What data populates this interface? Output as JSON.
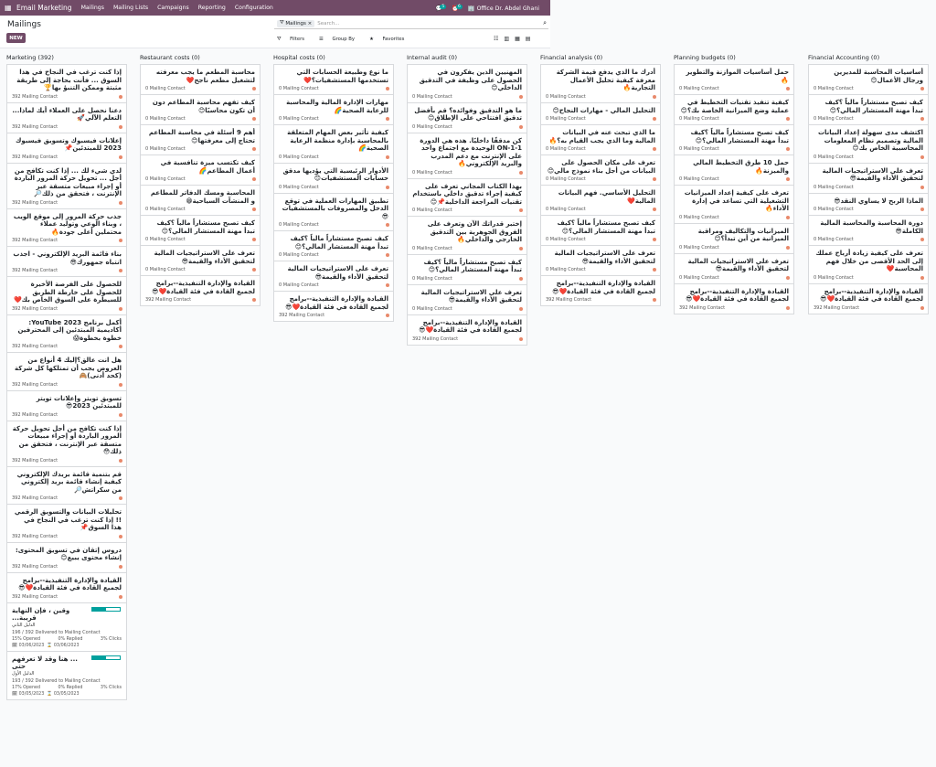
{
  "topbar": {
    "app_name": "Email Marketing",
    "menus": [
      "Mailings",
      "Mailing Lists",
      "Campaigns",
      "Reporting",
      "Configuration"
    ],
    "chat_count": "5",
    "activity_count": "6",
    "company": "Office Dr. Abdel Ghani"
  },
  "control": {
    "breadcrumb": "Mailings",
    "new_label": "NEW",
    "facet_label": "Mailings",
    "search_placeholder": "Search...",
    "filters": "Filters",
    "group_by": "Group By",
    "favorites": "Favorites"
  },
  "columns": [
    {
      "title": "Marketing (392)",
      "cards": [
        {
          "title": "إذا كنت ترغب في النجاح في هذا السوق ... فأنت بحاجة إلى طريقة مثبتة وممكن التنبؤ بها🏆",
          "meta": "392 Mailing Contact"
        },
        {
          "title": "دعنا نحصل على العملاء أيك لماذا... التعلم الآلي🚀",
          "meta": "392 Mailing Contact"
        },
        {
          "title": "إعلانات فيسبوك وتسويق فيسبوك 2023 للمبتدئين📌",
          "meta": "392 Mailing Contact"
        },
        {
          "title": "لدي شيء لك ... إذا كنت تكافح من أجل ... تحويل حركة المرور الباردة أو إجراء مبيعات متسقة عبر الإنترنت ، فتحقق من ذلك🔎",
          "meta": "392 Mailing Contact"
        },
        {
          "title": "جذب حركة المرور إلى موقع الويب ، وبناء الوعي وتوليد عملاء محتملين أعلى جودة🔥",
          "meta": "392 Mailing Contact"
        },
        {
          "title": "بناء قائمة البريد الإلكتروني - اجذب انتباه جمهورك😎",
          "meta": "392 Mailing Contact"
        },
        {
          "title": "للحصول على الفرصة الأخيرة للحصول على خارطة الطريق للسيطرة على السوق الخاص بك❤️",
          "meta": "392 Mailing Contact"
        },
        {
          "title": "أكمل برنامج YouTube 2023: أكاديمية المبتدئين إلى المحترفين خطوة بخطوة😱",
          "meta": "392 Mailing Contact"
        },
        {
          "title": "هل انت عالق؟إليك 4 أنواع من العروض يجب أن تمتلكها كل شركة (كحد أدنى)🙈",
          "meta": "392 Mailing Contact"
        },
        {
          "title": "تسويق تويتر وإعلانات تويتر للمبتدئين 2023😎",
          "meta": "392 Mailing Contact"
        },
        {
          "title": "إذا كنت تكافح من أجل تحويل حركة المرور الباردة أو إجراء مبيعات متسقة عبر الإنترنت ، فتحقق من ذلك😳",
          "meta": "392 Mailing Contact"
        },
        {
          "title": "قم بتنمية قائمة بريدك الإلكتروني كيفية إنشاء قائمة بريد إلكتروني من سكراتش🔎",
          "meta": "392 Mailing Contact"
        },
        {
          "title": "تحليلات البيانات والتسويق الرقمي !! إذا كنت ترغب في النجاح في هذا السوق📌",
          "meta": "392 Mailing Contact"
        },
        {
          "title": "دروس إتقان في تسويق المحتوى: إنشاء محتوى يبيع😊",
          "meta": "392 Mailing Contact"
        },
        {
          "title": "القيادة والإدارة التنفيذية--برامج لجميع القادة في فئة القيادة❤️😎",
          "meta": "392 Mailing Contact"
        }
      ],
      "stat_cards": [
        {
          "title": "وقين ، فإن النهاية قريبة...",
          "subtitle": "الدليل الثاني",
          "progress": 0.5,
          "delivered": "196 / 392 Delivered to Mailing Contact",
          "opened": "15% Opened",
          "replied": "0% Replied",
          "clicks": "3% Clicks",
          "date_from": "03/06/2023",
          "date_to": "03/06/2023"
        },
        {
          "title": "... هنا وقد لا تعرفهم حتى",
          "subtitle": "الدليل الأول",
          "progress": 0.49,
          "delivered": "193 / 392 Delivered to Mailing Contact",
          "opened": "17% Opened",
          "replied": "0% Replied",
          "clicks": "3% Clicks",
          "date_from": "03/05/2023",
          "date_to": "03/05/2023"
        }
      ]
    },
    {
      "title": "Restaurant costs (0)",
      "cards": [
        {
          "title": "محاسبة المطعم ما يجب معرفته لتشغيل مطعم ناجح❤️",
          "meta": "0 Mailing Contact"
        },
        {
          "title": "كيف تفهم محاسبة المطاعم دون أن تكون محاسبًا😊",
          "meta": "0 Mailing Contact"
        },
        {
          "title": "أهم 9 أسئلة في محاسبة المطاعم تحتاج إلى معرفتها😊",
          "meta": "0 Mailing Contact"
        },
        {
          "title": "كيف تكتسب ميزة تنافسية في أعمال المطاعم🌈",
          "meta": "0 Mailing Contact"
        },
        {
          "title": "المحاسبة ومسك الدفاتر للمطاعم و المنشآت السياحية😁",
          "meta": "0 Mailing Contact"
        },
        {
          "title": "كيف تصبح مستشاراً مالياً ؟كيف تبدأ مهنة المستشار المالي؟😊",
          "meta": "0 Mailing Contact"
        },
        {
          "title": "تعرف على الاستراتيجيات المالية لتحقيق الأداء والقيمة😎",
          "meta": "0 Mailing Contact"
        },
        {
          "title": "القيادة والإدارة التنفيذية--برامج لجميع القادة في فئة القيادة❤️😎",
          "meta": "392 Mailing Contact"
        }
      ]
    },
    {
      "title": "Hospital costs (0)",
      "cards": [
        {
          "title": "ما نوع وطبيعة الحسابات التي تستخدمها المستشفيات؟❤️",
          "meta": "0 Mailing Contact"
        },
        {
          "title": "مهارات الإدارة المالية والمحاسبة للرعاية الصحية🌈",
          "meta": "0 Mailing Contact"
        },
        {
          "title": "كيفية تأثير بعض المهام المتعلقة بالمحاسبة بإدارة منظمة الرعاية الصحية🌈",
          "meta": "0 Mailing Contact"
        },
        {
          "title": "الأدوار الرئيسية التي يؤديها مدقق حسابات المستشفيات😊",
          "meta": "0 Mailing Contact"
        },
        {
          "title": "تطبيق المهارات العملية في توقع الدخل والمصروفات بالمستشفيات😎",
          "meta": "0 Mailing Contact"
        },
        {
          "title": "كيف تصبح مستشاراً مالياً ؟كيف تبدأ مهنة المستشار المالي؟😊",
          "meta": "0 Mailing Contact"
        },
        {
          "title": "تعرف على الاستراتيجيات المالية لتحقيق الأداء والقيمة😎",
          "meta": "0 Mailing Contact"
        },
        {
          "title": "القيادة والإدارة التنفيذية--برامج لجميع القادة في فئة القيادة❤️😎",
          "meta": "392 Mailing Contact"
        }
      ]
    },
    {
      "title": "Internal audit (0)",
      "cards": [
        {
          "title": "المهنيين الذين يفكرون في الحصول على وظيفة في التدقيق الداخلي😊",
          "meta": "0 Mailing Contact"
        },
        {
          "title": "ما هو التدقيق وفوائده؟ قم بأفضل تدقيق افتتاحي على الإطلاق😊",
          "meta": "0 Mailing Contact"
        },
        {
          "title": "كن مدققًا داخليًا. هذه هي الدورة ON-1-1 الوحيدة مع اجتماع واحد على الإنترنت مع دعم المدرب والبريد الإلكتروني🔥",
          "meta": "0 Mailing Contact"
        },
        {
          "title": "بهذا الكتاب المجاني تعرف على كيفية إجراء تدقيق داخلي باستخدام تقنيات المراجعة الداخلية📌😊",
          "meta": "0 Mailing Contact"
        },
        {
          "title": "إختبر قدراتك الآن وتعرف على الفروق الجوهرية بين التدقيق الخارجي والداخلي🔥",
          "meta": "0 Mailing Contact"
        },
        {
          "title": "كيف تصبح مستشاراً مالياً ؟كيف تبدأ مهنة المستشار المالي؟😊",
          "meta": "0 Mailing Contact"
        },
        {
          "title": "تعرف على الاستراتيجيات المالية لتحقيق الأداء والقيمة😎",
          "meta": "0 Mailing Contact"
        },
        {
          "title": "القيادة والإدارة التنفيذية--برامج لجميع القادة في فئة القيادة❤️😎",
          "meta": "392 Mailing Contact"
        }
      ]
    },
    {
      "title": "Financial analysis (0)",
      "cards": [
        {
          "title": "أدرك ما الذي يدفع قيمة الشركة معرفة كيفية تحليل الأعمال التجارية🔥",
          "meta": "0 Mailing Contact"
        },
        {
          "title": "التحليل المالي - مهارات النجاح😊",
          "meta": "0 Mailing Contact"
        },
        {
          "title": "ما الذي تبحث عنه في البيانات المالية وما الذي يجب القيام به؟🔥",
          "meta": "0 Mailing Contact"
        },
        {
          "title": "تعرف على مكان الحصول على البيانات من أجل بناء نموذج مالي😊",
          "meta": "0 Mailing Contact"
        },
        {
          "title": "التحليل الأساسي. فهم البيانات المالية❤️",
          "meta": "0 Mailing Contact"
        },
        {
          "title": "كيف تصبح مستشاراً مالياً ؟كيف تبدأ مهنة المستشار المالي؟😊",
          "meta": "0 Mailing Contact"
        },
        {
          "title": "تعرف على الاستراتيجيات المالية لتحقيق الأداء والقيمة😎",
          "meta": "0 Mailing Contact"
        },
        {
          "title": "القيادة والإدارة التنفيذية--برامج لجميع القادة في فئة القيادة❤️😎",
          "meta": "392 Mailing Contact"
        }
      ]
    },
    {
      "title": "Planning budgets (0)",
      "cards": [
        {
          "title": "حمل أساسيات الموازنة والتطوير🔥",
          "meta": "0 Mailing Contact"
        },
        {
          "title": "كيفية تنفيذ تقنيات التخطيط في عملية وضع الميزانية الخاصة بك؟😊",
          "meta": "0 Mailing Contact"
        },
        {
          "title": "كيف تصبح مستشاراً مالياً ؟كيف تبدأ مهنة المستشار المالي؟😊",
          "meta": "0 Mailing Contact"
        },
        {
          "title": "حمل 10 طرق التخطيط المالي والميزنة🔥",
          "meta": "0 Mailing Contact"
        },
        {
          "title": "تعرف على كيفية إعداد الميزانيات التشغيلية التي تساعد في إدارة الأداء🔥",
          "meta": "0 Mailing Contact"
        },
        {
          "title": "الميزانيات والتكاليف ومراقبة الميزانية من أين تبدأ؟😊",
          "meta": "0 Mailing Contact"
        },
        {
          "title": "تعرف على الاستراتيجيات المالية لتحقيق الأداء والقيمة😎",
          "meta": "0 Mailing Contact"
        },
        {
          "title": "القيادة والإدارة التنفيذية--برامج لجميع القادة في فئة القيادة❤️😎",
          "meta": "392 Mailing Contact"
        }
      ]
    },
    {
      "title": "Financial Accounting (0)",
      "cards": [
        {
          "title": "أساسيات المحاسبة للمديرين ورجال الأعمال😊",
          "meta": "0 Mailing Contact"
        },
        {
          "title": "كيف تصبح مستشاراً مالياً ؟كيف تبدأ مهنة المستشار المالي؟😊",
          "meta": "0 Mailing Contact"
        },
        {
          "title": "اكتشف مدى سهولة إعداد البيانات المالية وتصميم نظام المعلومات المحاسبية الخاص بك😊",
          "meta": "0 Mailing Contact"
        },
        {
          "title": "تعرف على الاستراتيجيات المالية لتحقيق الأداء والقيمة😎",
          "meta": "0 Mailing Contact"
        },
        {
          "title": "الماذا الربح لا يساوي النقد😎",
          "meta": "0 Mailing Contact"
        },
        {
          "title": "دورة المحاسبة والمحاسبة المالية الكاملة😎",
          "meta": "0 Mailing Contact"
        },
        {
          "title": "تعرف على كيفية زيادة أرباح عملك إلى الحد الأقصى من خلال فهم المحاسبة❤️",
          "meta": "0 Mailing Contact"
        },
        {
          "title": "القيادة والإدارة التنفيذية--برامج لجميع القادة في فئة القيادة❤️😎",
          "meta": "392 Mailing Contact"
        }
      ]
    }
  ]
}
